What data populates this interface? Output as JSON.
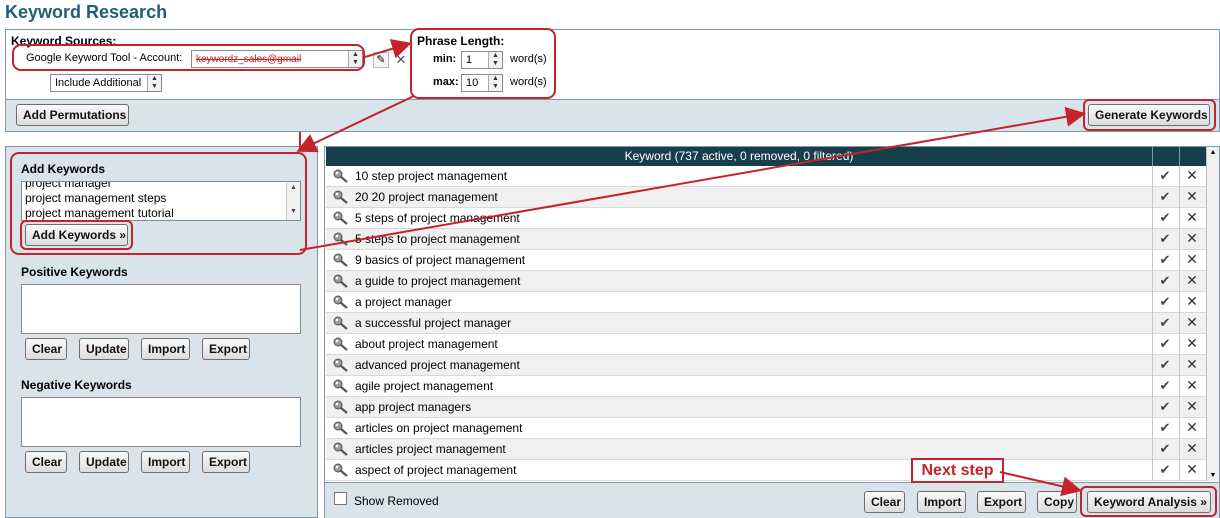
{
  "page": {
    "title": "Keyword Research"
  },
  "sources": {
    "label": "Keyword Sources:",
    "tool": "Google Keyword Tool - Account:",
    "account": "keywordz_sales@gmail",
    "include_additional": "Include Additional"
  },
  "phrase_length": {
    "title": "Phrase Length:",
    "min_label": "min:",
    "min_value": "1",
    "min_unit": "word(s)",
    "max_label": "max:",
    "max_value": "10",
    "max_unit": "word(s)"
  },
  "toolbar": {
    "add_permutations": "Add Permutations",
    "generate_keywords": "Generate Keywords"
  },
  "add_keywords": {
    "title": "Add Keywords",
    "lines": [
      "project manager",
      "project management steps",
      "project management tutorial"
    ],
    "button": "Add Keywords »"
  },
  "positive_keywords": {
    "title": "Positive Keywords",
    "buttons": [
      "Clear",
      "Update",
      "Import",
      "Export"
    ]
  },
  "negative_keywords": {
    "title": "Negative Keywords",
    "buttons": [
      "Clear",
      "Update",
      "Import",
      "Export"
    ]
  },
  "keyword_table": {
    "header": "Keyword (737 active, 0 removed, 0 filtered)",
    "rows": [
      "10 step project management",
      "20 20 project management",
      "5 steps of project management",
      "5 steps to project management",
      "9 basics of project management",
      "a guide to project management",
      "a project manager",
      "a successful project manager",
      "about project management",
      "advanced project management",
      "agile project management",
      "app project managers",
      "articles on project management",
      "articles project management",
      "aspect of project management"
    ],
    "check_glyph": "✔",
    "remove_glyph": "✕"
  },
  "footer": {
    "show_removed": "Show Removed",
    "clear": "Clear",
    "import": "Import",
    "export": "Export",
    "copy": "Copy",
    "keyword_analysis": "Keyword Analysis »"
  },
  "annotation": {
    "next_step": "Next step"
  },
  "colors": {
    "header_bg": "#173f4b",
    "title": "#1f5f73",
    "annotation": "#c4232b",
    "panel_bg": "#d8e4ea"
  }
}
